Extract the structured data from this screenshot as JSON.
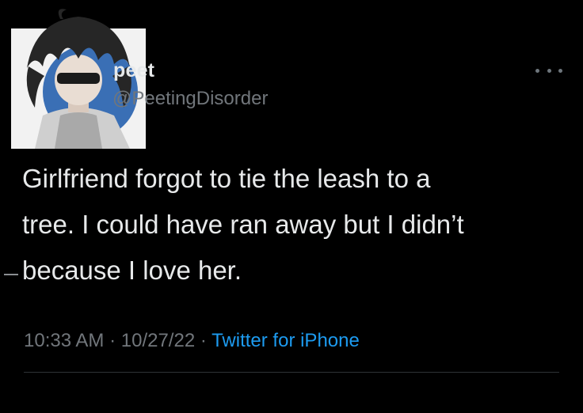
{
  "tweet": {
    "author": {
      "display_name": "peet",
      "handle": "@PeetingDisorder",
      "avatar_icon": "avatar-illustration"
    },
    "more_icon": "more-dots-icon",
    "text_lines": [
      "Girlfriend forgot to tie the leash to a",
      "tree. I could have ran away but I didn’t",
      "because I love her."
    ],
    "time": "10:33 AM",
    "separator": "·",
    "date": "10/27/22",
    "source": "Twitter for iPhone"
  },
  "colors": {
    "background": "#000000",
    "text_primary": "#e7e9ea",
    "text_secondary": "#71767b",
    "link": "#1d9bf0",
    "divider": "#2f3336"
  }
}
